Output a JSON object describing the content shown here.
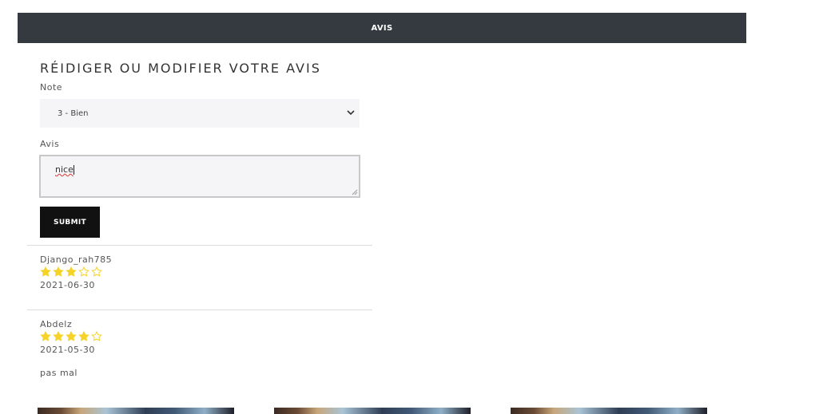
{
  "header": {
    "tab_label": "AVIS"
  },
  "form": {
    "title": "RÉIDIGER OU MODIFIER VOTRE AVIS",
    "rating_label": "Note",
    "rating_selected": "3 - Bien",
    "review_label": "Avis",
    "review_value": "nice",
    "submit_label": "SUBMIT"
  },
  "reviews": [
    {
      "author": "Django_rah785",
      "rating": 3,
      "max_rating": 5,
      "date": "2021-06-30",
      "text": ""
    },
    {
      "author": "Abdelz",
      "rating": 4,
      "max_rating": 5,
      "date": "2021-05-30",
      "text": "pas mal"
    }
  ],
  "colors": {
    "header_bg": "#343a40",
    "star_filled": "#f5d327",
    "button_bg": "#111111",
    "input_bg": "#f5f5f7"
  }
}
